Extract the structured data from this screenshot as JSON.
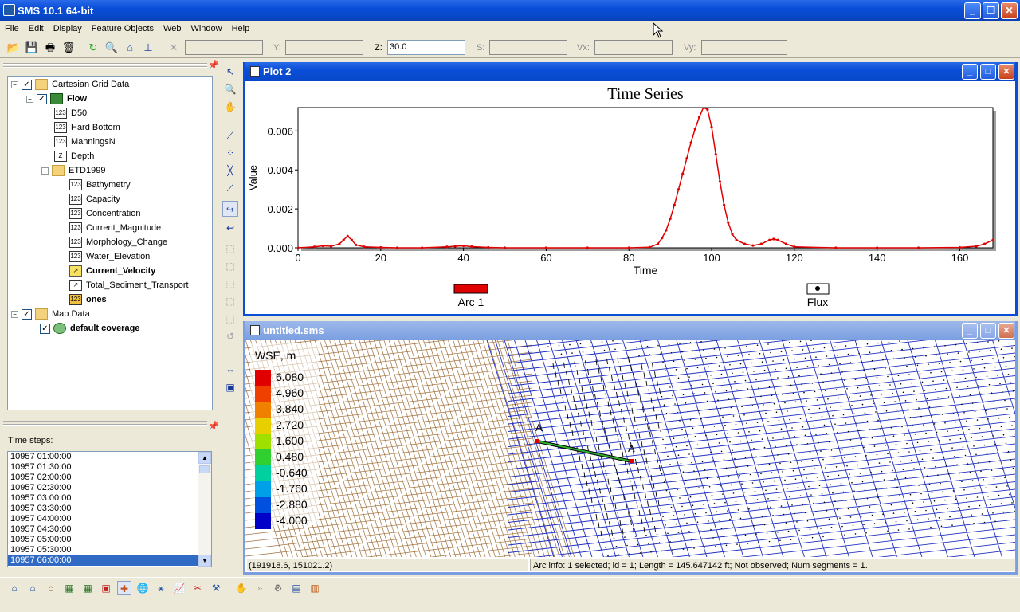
{
  "app": {
    "title": "SMS 10.1 64-bit"
  },
  "menu": [
    "File",
    "Edit",
    "Display",
    "Feature Objects",
    "Web",
    "Window",
    "Help"
  ],
  "coords": {
    "x_label": "X:",
    "y_label": "Y:",
    "z_label": "Z:",
    "z_value": "30.0",
    "s_label": "S:",
    "vx_label": "Vx:",
    "vy_label": "Vy:"
  },
  "tree": {
    "root": "Cartesian Grid Data",
    "flow": "Flow",
    "items": [
      "D50",
      "Hard Bottom",
      "ManningsN",
      "Depth"
    ],
    "etd": "ETD1999",
    "etd_items": [
      "Bathymetry",
      "Capacity",
      "Concentration",
      "Current_Magnitude",
      "Morphology_Change",
      "Water_Elevation",
      "Current_Velocity",
      "Total_Sediment_Transport",
      "ones"
    ],
    "map": "Map Data",
    "coverage": "default coverage",
    "icon_123": "123",
    "icon_z": "Z"
  },
  "timesteps": {
    "label": "Time steps:",
    "items": [
      "10957 01:00:00",
      "10957 01:30:00",
      "10957 02:00:00",
      "10957 02:30:00",
      "10957 03:00:00",
      "10957 03:30:00",
      "10957 04:00:00",
      "10957 04:30:00",
      "10957 05:00:00",
      "10957 05:30:00",
      "10957 06:00:00"
    ],
    "selected": 10
  },
  "plot": {
    "window_title": "Plot 2",
    "legend": [
      "Arc 1",
      "Flux"
    ],
    "chart_data": {
      "type": "line",
      "title": "Time Series",
      "xlabel": "Time",
      "ylabel": "Value",
      "xlim": [
        0,
        168
      ],
      "ylim": [
        0,
        0.0072
      ],
      "x_ticks": [
        0,
        20,
        40,
        60,
        80,
        100,
        120,
        140,
        160
      ],
      "y_ticks": [
        0.0,
        0.002,
        0.004,
        0.006
      ],
      "y_tick_labels": [
        "0.000",
        "0.002",
        "0.004",
        "0.006"
      ],
      "series": [
        {
          "name": "Arc 1",
          "color": "#e00000",
          "x": [
            0,
            4,
            6,
            8,
            10,
            11,
            12,
            13,
            14,
            16,
            20,
            24,
            30,
            36,
            38,
            40,
            42,
            46,
            50,
            60,
            70,
            80,
            85,
            87,
            88,
            89,
            90,
            91,
            92,
            93,
            94,
            95,
            96,
            97,
            98,
            99,
            100,
            101,
            102,
            103,
            104,
            105,
            106,
            108,
            110,
            112,
            114,
            115,
            116,
            118,
            120,
            130,
            140,
            150,
            160,
            164,
            166,
            168
          ],
          "y": [
            0.0,
            5e-05,
            0.0001,
            8e-05,
            0.0002,
            0.0004,
            0.0006,
            0.0004,
            0.00015,
            5e-05,
            2e-05,
            0.0,
            0.0,
            5e-05,
            8e-05,
            0.0001,
            6e-05,
            2e-05,
            0.0,
            0.0,
            0.0,
            0.0,
            3e-05,
            0.0002,
            0.0005,
            0.0009,
            0.0015,
            0.0022,
            0.003,
            0.0038,
            0.0046,
            0.0054,
            0.0061,
            0.0067,
            0.0072,
            0.0071,
            0.0062,
            0.0048,
            0.0034,
            0.0022,
            0.0013,
            0.0007,
            0.0004,
            0.0002,
            0.00012,
            0.0002,
            0.0004,
            0.00045,
            0.0004,
            0.0002,
            5e-05,
            0.0,
            0.0,
            0.0,
            2e-05,
            8e-05,
            0.0002,
            0.0004
          ]
        }
      ]
    }
  },
  "view": {
    "window_title": "untitled.sms",
    "legend_title": "WSE, m",
    "legend_values": [
      "6.080",
      "4.960",
      "3.840",
      "2.720",
      "1.600",
      "0.480",
      "-0.640",
      "-1.760",
      "-2.880",
      "-4.000"
    ],
    "legend_colors": [
      "#e00000",
      "#f04000",
      "#f08000",
      "#e8d000",
      "#a0e000",
      "#30d030",
      "#00d0a0",
      "#00a0e8",
      "#0050e0",
      "#0000c8"
    ],
    "arc_end_a": "A",
    "arc_end_b": "A",
    "status_coords": "(191918.6, 151021.2)",
    "status_info": "Arc info: 1 selected; id = 1; Length = 145.647142 ft; Not observed; Num segments = 1."
  }
}
